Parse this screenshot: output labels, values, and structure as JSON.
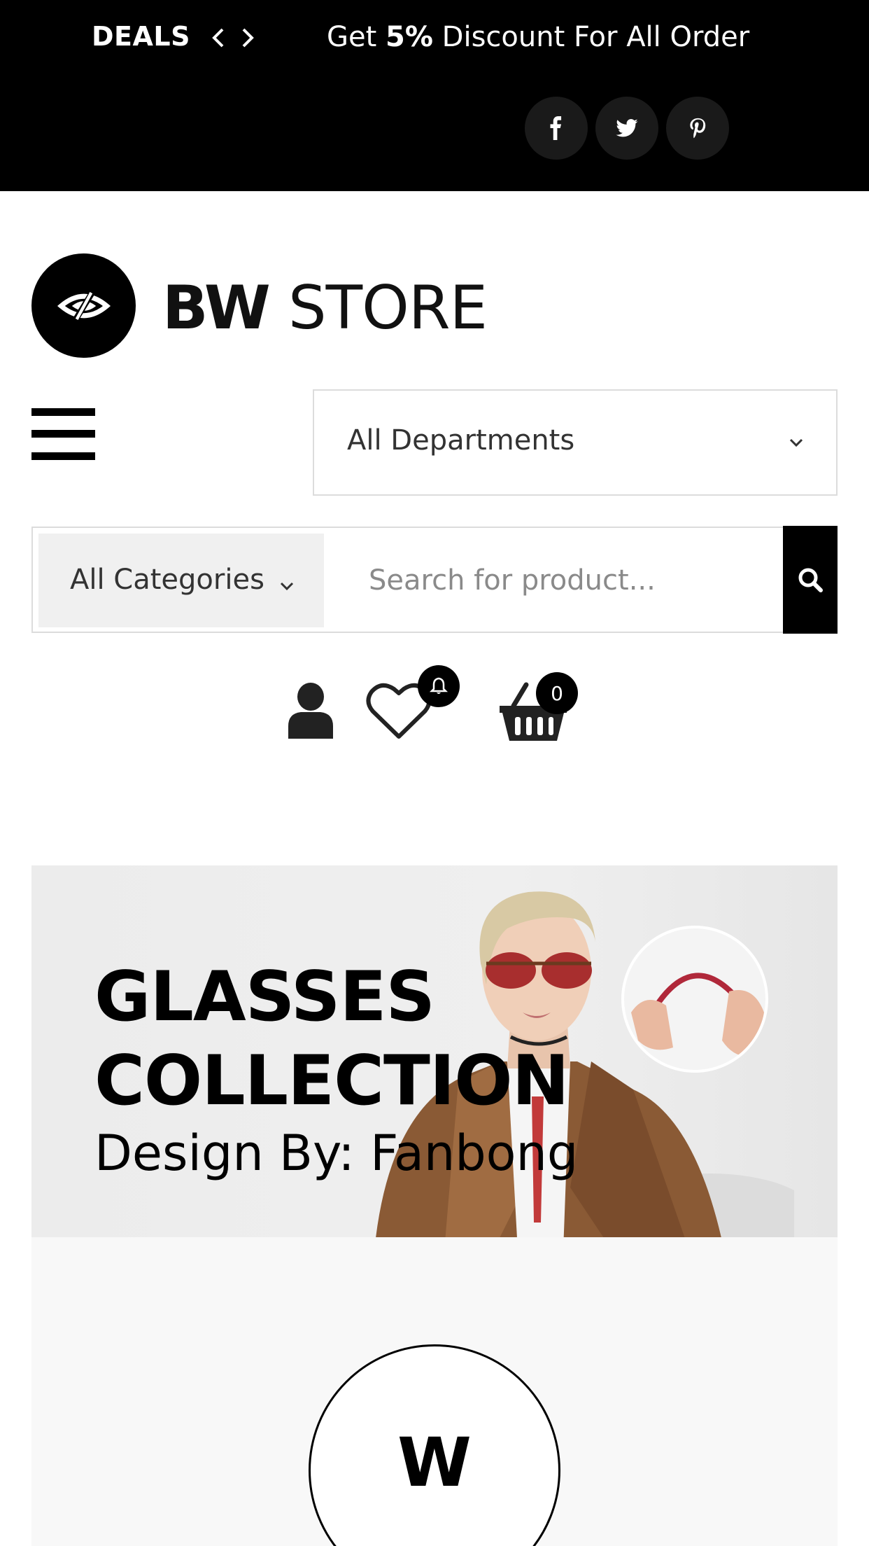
{
  "topbar": {
    "deals_label": "DEALS",
    "promo_prefix": "Get ",
    "promo_highlight": "5%",
    "promo_suffix": " Discount For All Order",
    "social": [
      "facebook-icon",
      "twitter-icon",
      "pinterest-icon"
    ],
    "background": "#000000"
  },
  "logo": {
    "brand_bold": "BW",
    "brand_light": " STORE"
  },
  "departments": {
    "selected": "All Departments"
  },
  "search": {
    "category_selected": "All Categories",
    "placeholder": "Search for product..."
  },
  "header_icons": {
    "wishlist_badge": "bell-icon",
    "cart_count": "0"
  },
  "banner": {
    "title_line1": "GLASSES",
    "title_line2": "COLLECTION",
    "subtitle": "Design By: Fanbong"
  },
  "brands": {
    "first_logo_letter": "W"
  },
  "colors": {
    "accent": "#000000",
    "text": "#333333",
    "border": "#dcdcdc"
  }
}
